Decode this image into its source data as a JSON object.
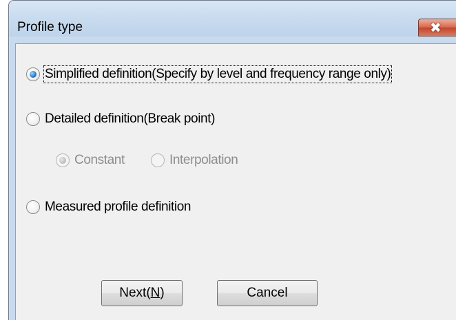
{
  "window": {
    "title": "Profile type",
    "close_symbol": "✖"
  },
  "options": {
    "simplified": {
      "label": "Simplified definition(Specify by level and frequency range only)",
      "checked": true
    },
    "detailed": {
      "label": "Detailed definition(Break point)",
      "checked": false
    },
    "constant": {
      "label": "Constant",
      "checked": true,
      "enabled": false
    },
    "interpolation": {
      "label": "Interpolation",
      "checked": false,
      "enabled": false
    },
    "measured": {
      "label": "Measured profile definition",
      "checked": false
    }
  },
  "buttons": {
    "next_prefix": "Next(",
    "next_hotkey": "N",
    "next_suffix": ")",
    "cancel": "Cancel"
  }
}
